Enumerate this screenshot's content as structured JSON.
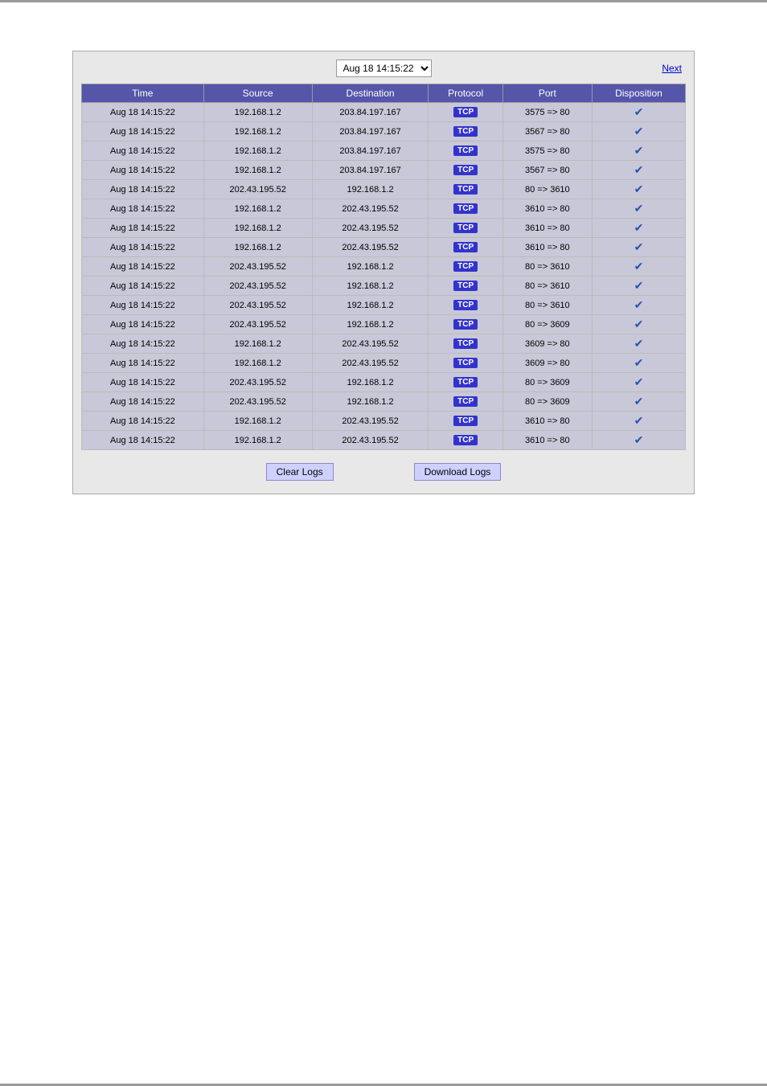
{
  "header": {
    "datetime_value": "Aug 18 14:15:22",
    "next_label": "Next"
  },
  "table": {
    "columns": [
      "Time",
      "Source",
      "Destination",
      "Protocol",
      "Port",
      "Disposition"
    ],
    "rows": [
      {
        "time": "Aug 18 14:15:22",
        "source": "192.168.1.2",
        "destination": "203.84.197.167",
        "protocol": "TCP",
        "port": "3575 => 80",
        "disposition": "✓"
      },
      {
        "time": "Aug 18 14:15:22",
        "source": "192.168.1.2",
        "destination": "203.84.197.167",
        "protocol": "TCP",
        "port": "3567 => 80",
        "disposition": "✓"
      },
      {
        "time": "Aug 18 14:15:22",
        "source": "192.168.1.2",
        "destination": "203.84.197.167",
        "protocol": "TCP",
        "port": "3575 => 80",
        "disposition": "✓"
      },
      {
        "time": "Aug 18 14:15:22",
        "source": "192.168.1.2",
        "destination": "203.84.197.167",
        "protocol": "TCP",
        "port": "3567 => 80",
        "disposition": "✓"
      },
      {
        "time": "Aug 18 14:15:22",
        "source": "202.43.195.52",
        "destination": "192.168.1.2",
        "protocol": "TCP",
        "port": "80 => 3610",
        "disposition": "✓"
      },
      {
        "time": "Aug 18 14:15:22",
        "source": "192.168.1.2",
        "destination": "202.43.195.52",
        "protocol": "TCP",
        "port": "3610 => 80",
        "disposition": "✓"
      },
      {
        "time": "Aug 18 14:15:22",
        "source": "192.168.1.2",
        "destination": "202.43.195.52",
        "protocol": "TCP",
        "port": "3610 => 80",
        "disposition": "✓"
      },
      {
        "time": "Aug 18 14:15:22",
        "source": "192.168.1.2",
        "destination": "202.43.195.52",
        "protocol": "TCP",
        "port": "3610 => 80",
        "disposition": "✓"
      },
      {
        "time": "Aug 18 14:15:22",
        "source": "202.43.195.52",
        "destination": "192.168.1.2",
        "protocol": "TCP",
        "port": "80 => 3610",
        "disposition": "✓"
      },
      {
        "time": "Aug 18 14:15:22",
        "source": "202.43.195.52",
        "destination": "192.168.1.2",
        "protocol": "TCP",
        "port": "80 => 3610",
        "disposition": "✓"
      },
      {
        "time": "Aug 18 14:15:22",
        "source": "202.43.195.52",
        "destination": "192.168.1.2",
        "protocol": "TCP",
        "port": "80 => 3610",
        "disposition": "✓"
      },
      {
        "time": "Aug 18 14:15:22",
        "source": "202.43.195.52",
        "destination": "192.168.1.2",
        "protocol": "TCP",
        "port": "80 => 3609",
        "disposition": "✓"
      },
      {
        "time": "Aug 18 14:15:22",
        "source": "192.168.1.2",
        "destination": "202.43.195.52",
        "protocol": "TCP",
        "port": "3609 => 80",
        "disposition": "✓"
      },
      {
        "time": "Aug 18 14:15:22",
        "source": "192.168.1.2",
        "destination": "202.43.195.52",
        "protocol": "TCP",
        "port": "3609 => 80",
        "disposition": "✓"
      },
      {
        "time": "Aug 18 14:15:22",
        "source": "202.43.195.52",
        "destination": "192.168.1.2",
        "protocol": "TCP",
        "port": "80 => 3609",
        "disposition": "✓"
      },
      {
        "time": "Aug 18 14:15:22",
        "source": "202.43.195.52",
        "destination": "192.168.1.2",
        "protocol": "TCP",
        "port": "80 => 3609",
        "disposition": "✓"
      },
      {
        "time": "Aug 18 14:15:22",
        "source": "192.168.1.2",
        "destination": "202.43.195.52",
        "protocol": "TCP",
        "port": "3610 => 80",
        "disposition": "✓"
      },
      {
        "time": "Aug 18 14:15:22",
        "source": "192.168.1.2",
        "destination": "202.43.195.52",
        "protocol": "TCP",
        "port": "3610 => 80",
        "disposition": "✓"
      }
    ]
  },
  "footer": {
    "clear_logs_label": "Clear Logs",
    "download_logs_label": "Download  Logs"
  }
}
